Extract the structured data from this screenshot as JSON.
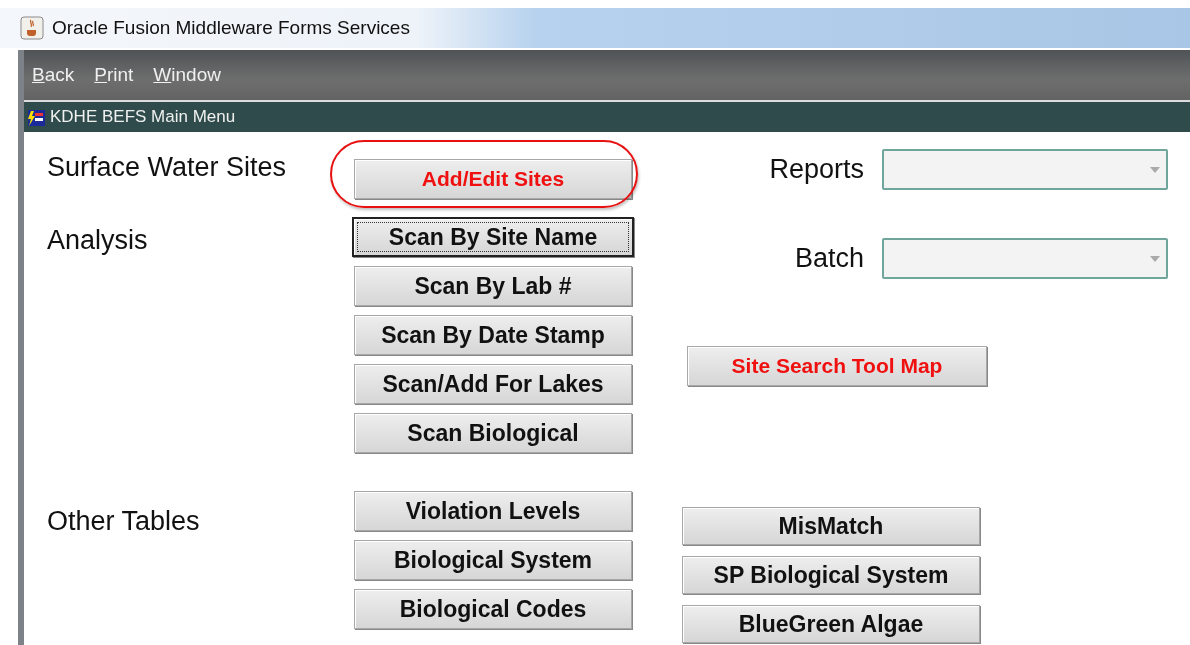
{
  "window": {
    "title": "Oracle Fusion Middleware Forms Services"
  },
  "menu": [
    {
      "label": "Back"
    },
    {
      "label": "Print"
    },
    {
      "label": "Window"
    }
  ],
  "form": {
    "title": "KDHE BEFS Main Menu"
  },
  "sections": [
    {
      "label": "Surface Water Sites",
      "buttons": [
        {
          "label": "Add/Edit Sites",
          "emphasis": true,
          "focused": false,
          "circled": true
        }
      ]
    },
    {
      "label": "Analysis",
      "buttons": [
        {
          "label": "Scan By Site Name",
          "emphasis": false,
          "focused": true,
          "circled": false
        },
        {
          "label": "Scan By Lab #",
          "emphasis": false,
          "focused": false,
          "circled": false
        },
        {
          "label": "Scan By Date Stamp",
          "emphasis": false,
          "focused": false,
          "circled": false
        },
        {
          "label": "Scan/Add For Lakes",
          "emphasis": false,
          "focused": false,
          "circled": false
        },
        {
          "label": "Scan Biological",
          "emphasis": false,
          "focused": false,
          "circled": false
        }
      ]
    },
    {
      "label": "Other Tables",
      "buttons": [
        {
          "label": "Violation Levels",
          "emphasis": false,
          "focused": false,
          "circled": false
        },
        {
          "label": "Biological System",
          "emphasis": false,
          "focused": false,
          "circled": false
        },
        {
          "label": "Biological Codes",
          "emphasis": false,
          "focused": false,
          "circled": false
        }
      ]
    }
  ],
  "dropdowns": [
    {
      "label": "Reports"
    },
    {
      "label": "Batch"
    }
  ],
  "map_button": {
    "label": "Site Search Tool Map",
    "emphasis": true
  },
  "other_tables_extra": [
    {
      "label": "MisMatch",
      "emphasis": false
    },
    {
      "label": "SP Biological System",
      "emphasis": false
    },
    {
      "label": "BlueGreen Algae",
      "emphasis": false
    }
  ]
}
